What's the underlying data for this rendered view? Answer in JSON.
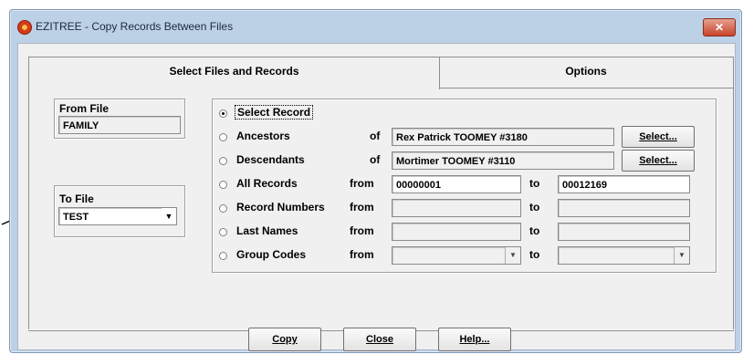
{
  "window": {
    "title": "EZITREE - Copy Records Between Files",
    "close_glyph": "✕"
  },
  "tabs": {
    "select_files": "Select Files and Records",
    "options": "Options"
  },
  "from_file": {
    "label": "From File",
    "value": "FAMILY"
  },
  "to_file": {
    "label": "To File",
    "value": "TEST",
    "dropdown_icon": "chevron-down-icon"
  },
  "records": {
    "select_record": "Select Record",
    "ancestors": {
      "label": "Ancestors",
      "of": "of",
      "value": "Rex Patrick TOOMEY  #3180",
      "button": "Select..."
    },
    "descendants": {
      "label": "Descendants",
      "of": "of",
      "value": "Mortimer TOOMEY  #3110",
      "button": "Select..."
    },
    "all_records": {
      "label": "All Records",
      "from": "from",
      "from_value": "00000001",
      "to": "to",
      "to_value": "00012169"
    },
    "record_numbers": {
      "label": "Record Numbers",
      "from": "from",
      "from_value": "",
      "to": "to",
      "to_value": ""
    },
    "last_names": {
      "label": "Last Names",
      "from": "from",
      "from_value": "",
      "to": "to",
      "to_value": ""
    },
    "group_codes": {
      "label": "Group Codes",
      "from": "from",
      "from_value": "",
      "to": "to",
      "to_value": ""
    },
    "selected": "select_record"
  },
  "buttons": {
    "copy": "Copy",
    "close": "Close",
    "help": "Help..."
  },
  "arrow_glyph": "▼",
  "colors": {
    "title_bar": "#bcd0e6",
    "close_red": "#c8432a",
    "dialog_bg": "#f0f0f0"
  }
}
